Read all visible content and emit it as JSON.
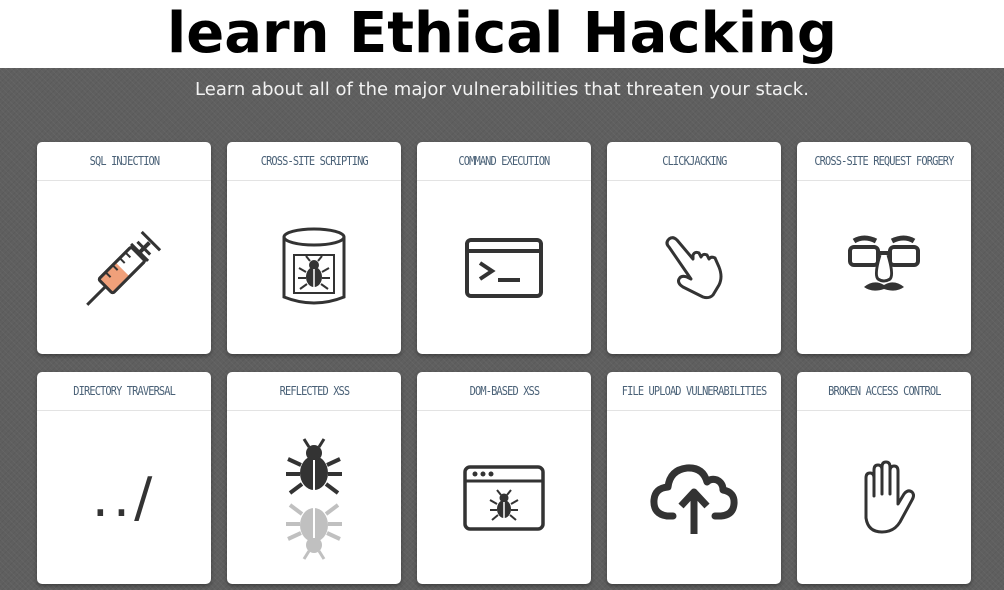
{
  "page": {
    "title": "learn Ethical Hacking"
  },
  "banner": {
    "subtitle": "Learn about all of the major vulnerabilities that threaten your stack."
  },
  "cards": [
    {
      "title": "SQL INJECTION",
      "icon": "syringe-icon"
    },
    {
      "title": "CROSS-SITE SCRIPTING",
      "icon": "bug-in-jar-icon"
    },
    {
      "title": "COMMAND EXECUTION",
      "icon": "terminal-icon"
    },
    {
      "title": "CLICKJACKING",
      "icon": "pointer-hand-icon"
    },
    {
      "title": "CROSS-SITE REQUEST FORGERY",
      "icon": "disguise-glasses-icon"
    },
    {
      "title": "DIRECTORY TRAVERSAL",
      "icon": "dot-dot-slash-icon",
      "glyph": "../"
    },
    {
      "title": "REFLECTED XSS",
      "icon": "reflected-bug-icon"
    },
    {
      "title": "DOM-BASED XSS",
      "icon": "bug-in-browser-icon"
    },
    {
      "title": "FILE UPLOAD VULNERABILITIES",
      "icon": "cloud-upload-icon"
    },
    {
      "title": "BROKEN ACCESS CONTROL",
      "icon": "stop-hand-icon"
    }
  ],
  "colors": {
    "panel": "#5f5f5f",
    "card_title": "#4a6177",
    "syringe_fill": "#f0a07a",
    "icon_stroke": "#333333"
  }
}
